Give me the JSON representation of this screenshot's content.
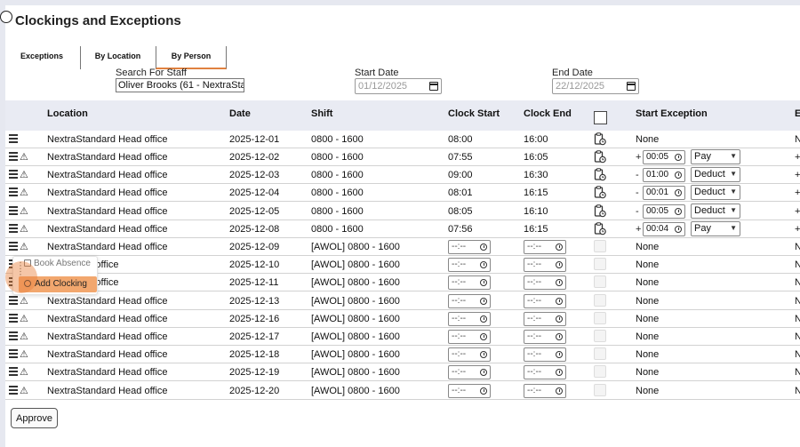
{
  "page": {
    "title": "Clockings and Exceptions"
  },
  "tabs": [
    {
      "label": "Exceptions"
    },
    {
      "label": "By Location"
    },
    {
      "label": "By Person"
    }
  ],
  "filters": {
    "staff_label": "Search For Staff",
    "staff_value": "Oliver Brooks (61 - NextraSta",
    "start_label": "Start Date",
    "start_value": "01/12/2025",
    "end_label": "End Date",
    "end_value": "22/12/2025"
  },
  "table": {
    "headers": {
      "location": "Location",
      "date": "Date",
      "shift": "Shift",
      "clock_start": "Clock Start",
      "clock_end": "Clock End",
      "start_exception": "Start Exception",
      "next": "E"
    },
    "time_placeholder": "--:--",
    "rows": [
      {
        "location": "NextraStandard Head office",
        "date": "2025-12-01",
        "shift": "0800 - 1600",
        "clock_start": "08:00",
        "clock_end": "16:00",
        "exc_none": "None",
        "last": "N"
      },
      {
        "location": "NextraStandard Head office",
        "date": "2025-12-02",
        "shift": "0800 - 1600",
        "clock_start": "07:55",
        "clock_end": "16:05",
        "exc_sign": "+",
        "exc_time": "00:05",
        "exc_type": "Pay",
        "last": "+"
      },
      {
        "location": "NextraStandard Head office",
        "date": "2025-12-03",
        "shift": "0800 - 1600",
        "clock_start": "09:00",
        "clock_end": "16:30",
        "exc_sign": "-",
        "exc_time": "01:00",
        "exc_type": "Deduct",
        "last": "+"
      },
      {
        "location": "NextraStandard Head office",
        "date": "2025-12-04",
        "shift": "0800 - 1600",
        "clock_start": "08:01",
        "clock_end": "16:15",
        "exc_sign": "-",
        "exc_time": "00:01",
        "exc_type": "Deduct",
        "last": "+"
      },
      {
        "location": "NextraStandard Head office",
        "date": "2025-12-05",
        "shift": "0800 - 1600",
        "clock_start": "08:05",
        "clock_end": "16:10",
        "exc_sign": "-",
        "exc_time": "00:05",
        "exc_type": "Deduct",
        "last": "+"
      },
      {
        "location": "NextraStandard Head office",
        "date": "2025-12-08",
        "shift": "0800 - 1600",
        "clock_start": "07:56",
        "clock_end": "16:15",
        "exc_sign": "+",
        "exc_time": "00:04",
        "exc_type": "Pay",
        "last": "+"
      },
      {
        "location": "NextraStandard Head office",
        "date": "2025-12-09",
        "shift": "[AWOL] 0800 - 1600",
        "exc_none": "None",
        "last": "N"
      },
      {
        "location": "dard Head office",
        "date": "2025-12-10",
        "shift": "[AWOL] 0800 - 1600",
        "exc_none": "None",
        "last": "N"
      },
      {
        "location": "dard Head office",
        "date": "2025-12-11",
        "shift": "[AWOL] 0800 - 1600",
        "exc_none": "None",
        "last": "N"
      },
      {
        "location": "NextraStandard Head office",
        "date": "2025-12-13",
        "shift": "[AWOL] 0800 - 1600",
        "exc_none": "None",
        "last": "N"
      },
      {
        "location": "NextraStandard Head office",
        "date": "2025-12-16",
        "shift": "[AWOL] 0800 - 1600",
        "exc_none": "None",
        "last": "N"
      },
      {
        "location": "NextraStandard Head office",
        "date": "2025-12-17",
        "shift": "[AWOL] 0800 - 1600",
        "exc_none": "None",
        "last": "N"
      },
      {
        "location": "NextraStandard Head office",
        "date": "2025-12-18",
        "shift": "[AWOL] 0800 - 1600",
        "exc_none": "None",
        "last": "N"
      },
      {
        "location": "NextraStandard Head office",
        "date": "2025-12-19",
        "shift": "[AWOL] 0800 - 1600",
        "exc_none": "None",
        "last": "N"
      },
      {
        "location": "NextraStandard Head office",
        "date": "2025-12-20",
        "shift": "[AWOL] 0800 - 1600",
        "exc_none": "None",
        "last": "N"
      }
    ]
  },
  "context_menu": {
    "book_absence": "Book Absence",
    "add_clocking": "Add Clocking"
  },
  "approve_label": "Approve",
  "colors": {
    "accent": "#e0813f",
    "header_bg": "#e9ebf3",
    "highlight": "#f2a76e"
  },
  "icons": {
    "row_menu": "hamburger-icon",
    "row_warning": "warning-triangle-icon",
    "row_action": "clipboard-clock-icon",
    "date_picker": "calendar-icon",
    "time_picker": "clock-icon"
  }
}
